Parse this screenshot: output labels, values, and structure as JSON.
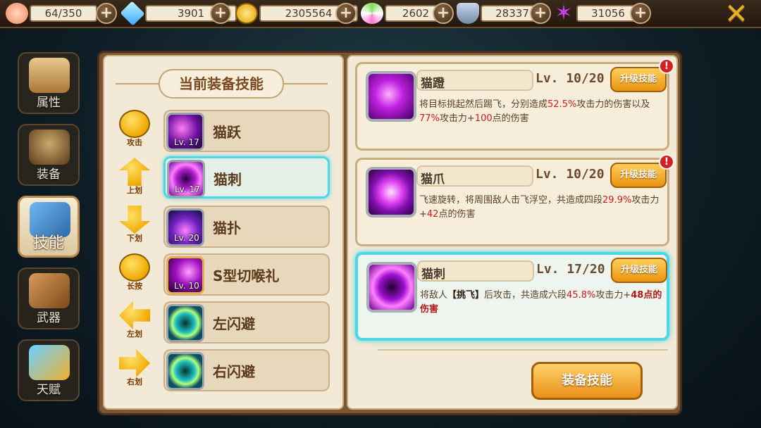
{
  "resources": [
    {
      "icon": "peach-icon",
      "value": "64/350"
    },
    {
      "icon": "diamond-icon",
      "value": "3901"
    },
    {
      "icon": "coin-icon",
      "value": "2305564"
    },
    {
      "icon": "lollipop-icon",
      "value": "2602"
    },
    {
      "icon": "badge-icon",
      "value": "28337"
    },
    {
      "icon": "purple-star-icon",
      "value": "31056"
    }
  ],
  "plus_label": "+",
  "close_label": "✕",
  "nav": [
    {
      "label": "属性",
      "name": "attributes"
    },
    {
      "label": "装备",
      "name": "equipment"
    },
    {
      "label": "技能",
      "name": "skills",
      "active": true
    },
    {
      "label": "武器",
      "name": "weapons"
    },
    {
      "label": "天赋",
      "name": "talents"
    }
  ],
  "section_title": "当前装备技能",
  "equipped_skills": [
    {
      "trigger": "攻击",
      "name": "猫跃",
      "level": "Lv. 17"
    },
    {
      "trigger": "上划",
      "name": "猫刺",
      "level": "Lv. 17",
      "selected": true
    },
    {
      "trigger": "下划",
      "name": "猫扑",
      "level": "Lv. 20"
    },
    {
      "trigger": "长按",
      "name": "S型切喉礼",
      "level": "Lv. 10"
    },
    {
      "trigger": "左划",
      "name": "左闪避",
      "level": ""
    },
    {
      "trigger": "右划",
      "name": "右闪避",
      "level": ""
    }
  ],
  "skill_cards": [
    {
      "name": "猫蹬",
      "level": "Lv. 10/20",
      "upgrade": "升级技能",
      "alert": true,
      "desc": {
        "p1": "将目标挑起然后踢飞，分别造成",
        "v1": "52.5%",
        "p2": "攻击力的伤害以及",
        "v2": "77%",
        "p3": "攻击力+",
        "v3": "100",
        "p4": "点的伤害"
      }
    },
    {
      "name": "猫爪",
      "level": "Lv. 10/20",
      "upgrade": "升级技能",
      "alert": true,
      "desc": {
        "p1": "飞速旋转，将周围敌人击飞浮空，共造成四段",
        "v1": "29.9%",
        "p2": "攻击力+",
        "v2": "42",
        "p3": "点的伤害"
      }
    },
    {
      "name": "猫刺",
      "level": "Lv. 17/20",
      "upgrade": "升级技能",
      "alert": false,
      "selected": true,
      "desc": {
        "p1": "将敌人",
        "kw": "【挑飞】",
        "p2": "后攻击，共造成六段",
        "v1": "45.8%",
        "p3": "攻击力+",
        "v2": "48点的伤害"
      }
    }
  ],
  "alert_label": "!",
  "equip_button": "装备技能"
}
